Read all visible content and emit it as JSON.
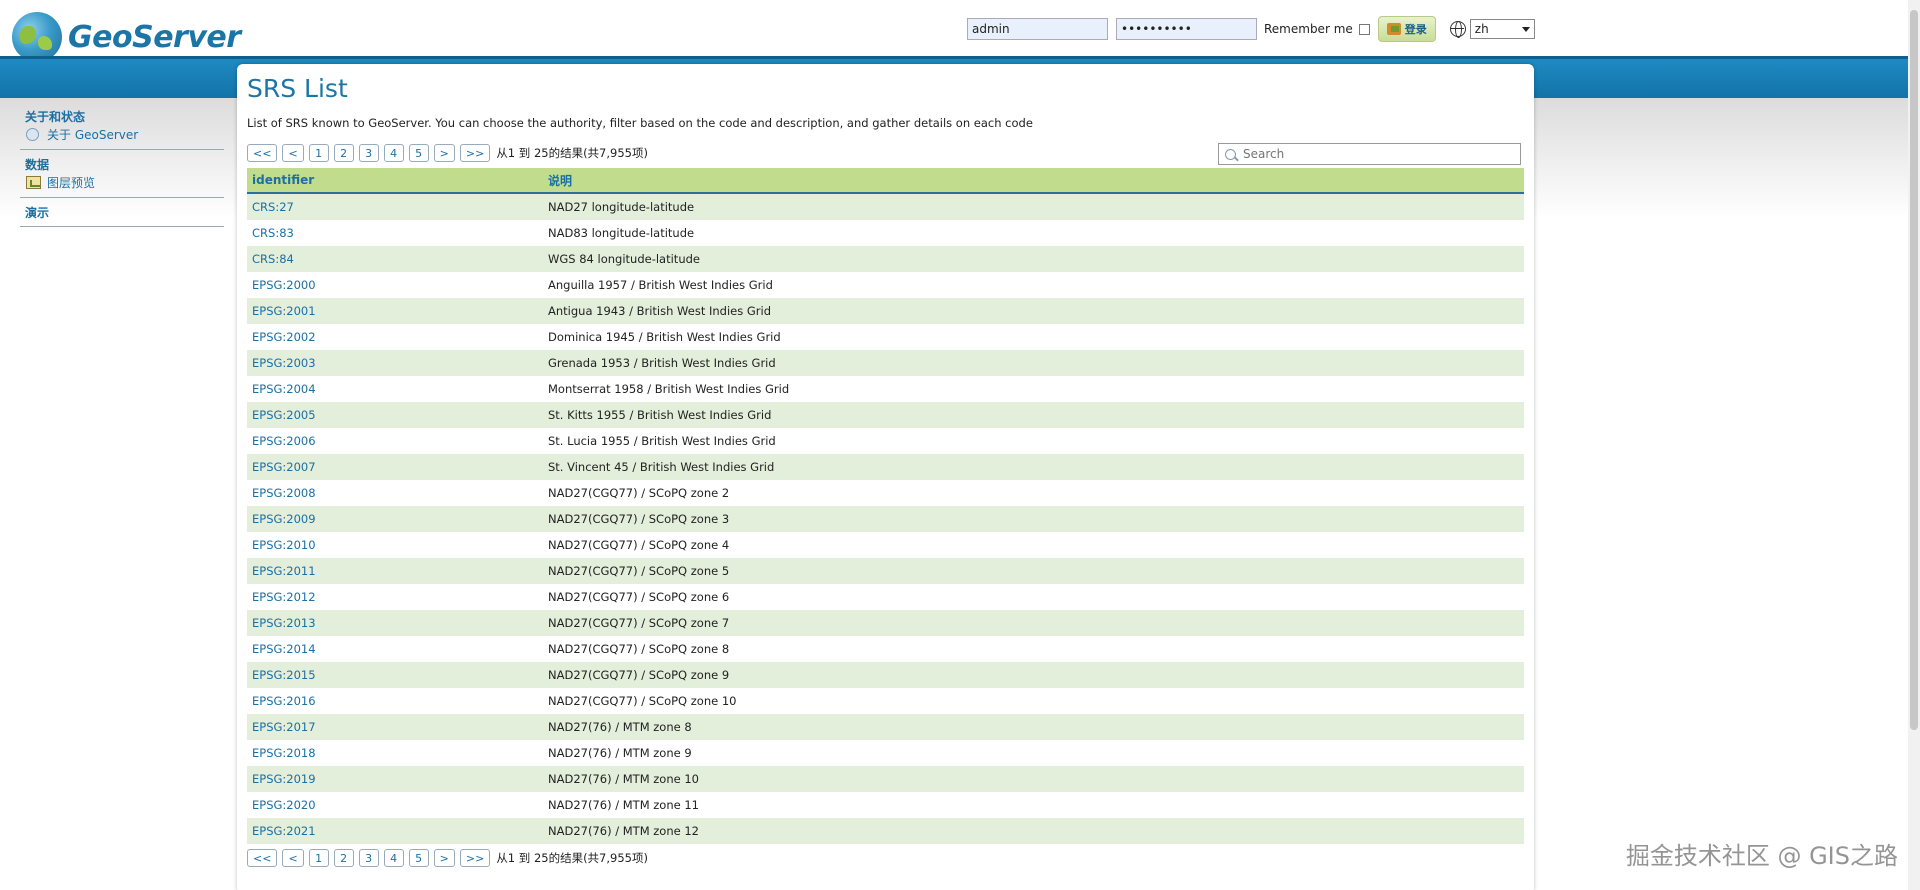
{
  "header": {
    "logo_text": "GeoServer",
    "username_value": "admin",
    "password_value": "••••••••••",
    "remember_label": "Remember me",
    "login_label": "登录",
    "lang_value": "zh"
  },
  "sidebar": {
    "groups": [
      {
        "title": "关于和状态",
        "items": [
          {
            "label": "关于 GeoServer",
            "icon": "info-icon"
          }
        ]
      },
      {
        "title": "数据",
        "items": [
          {
            "label": "图层预览",
            "icon": "layer-preview-icon"
          }
        ]
      },
      {
        "title": "演示",
        "items": []
      }
    ]
  },
  "main": {
    "title": "SRS List",
    "description": "List of SRS known to GeoServer. You can choose the authority, filter based on the code and description, and gather details on each code",
    "search_placeholder": "Search",
    "pager": {
      "first": "<<",
      "prev": "<",
      "pages": [
        "1",
        "2",
        "3",
        "4",
        "5"
      ],
      "next": ">",
      "last": ">>",
      "info": "从1 到 25的结果(共7,955项)"
    },
    "table": {
      "headers": [
        "identifier",
        "说明"
      ],
      "rows": [
        [
          "CRS:27",
          "NAD27 longitude-latitude"
        ],
        [
          "CRS:83",
          "NAD83 longitude-latitude"
        ],
        [
          "CRS:84",
          "WGS 84 longitude-latitude"
        ],
        [
          "EPSG:2000",
          "Anguilla 1957 / British West Indies Grid"
        ],
        [
          "EPSG:2001",
          "Antigua 1943 / British West Indies Grid"
        ],
        [
          "EPSG:2002",
          "Dominica 1945 / British West Indies Grid"
        ],
        [
          "EPSG:2003",
          "Grenada 1953 / British West Indies Grid"
        ],
        [
          "EPSG:2004",
          "Montserrat 1958 / British West Indies Grid"
        ],
        [
          "EPSG:2005",
          "St. Kitts 1955 / British West Indies Grid"
        ],
        [
          "EPSG:2006",
          "St. Lucia 1955 / British West Indies Grid"
        ],
        [
          "EPSG:2007",
          "St. Vincent 45 / British West Indies Grid"
        ],
        [
          "EPSG:2008",
          "NAD27(CGQ77) / SCoPQ zone 2"
        ],
        [
          "EPSG:2009",
          "NAD27(CGQ77) / SCoPQ zone 3"
        ],
        [
          "EPSG:2010",
          "NAD27(CGQ77) / SCoPQ zone 4"
        ],
        [
          "EPSG:2011",
          "NAD27(CGQ77) / SCoPQ zone 5"
        ],
        [
          "EPSG:2012",
          "NAD27(CGQ77) / SCoPQ zone 6"
        ],
        [
          "EPSG:2013",
          "NAD27(CGQ77) / SCoPQ zone 7"
        ],
        [
          "EPSG:2014",
          "NAD27(CGQ77) / SCoPQ zone 8"
        ],
        [
          "EPSG:2015",
          "NAD27(CGQ77) / SCoPQ zone 9"
        ],
        [
          "EPSG:2016",
          "NAD27(CGQ77) / SCoPQ zone 10"
        ],
        [
          "EPSG:2017",
          "NAD27(76) / MTM zone 8"
        ],
        [
          "EPSG:2018",
          "NAD27(76) / MTM zone 9"
        ],
        [
          "EPSG:2019",
          "NAD27(76) / MTM zone 10"
        ],
        [
          "EPSG:2020",
          "NAD27(76) / MTM zone 11"
        ],
        [
          "EPSG:2021",
          "NAD27(76) / MTM zone 12"
        ]
      ]
    }
  },
  "watermark": "掘金技术社区 @ GIS之路",
  "colors": {
    "accent": "#1b75a7",
    "band": "#1273a8",
    "row_alt": "#e3eedb",
    "table_header": "#c1dc8d"
  }
}
